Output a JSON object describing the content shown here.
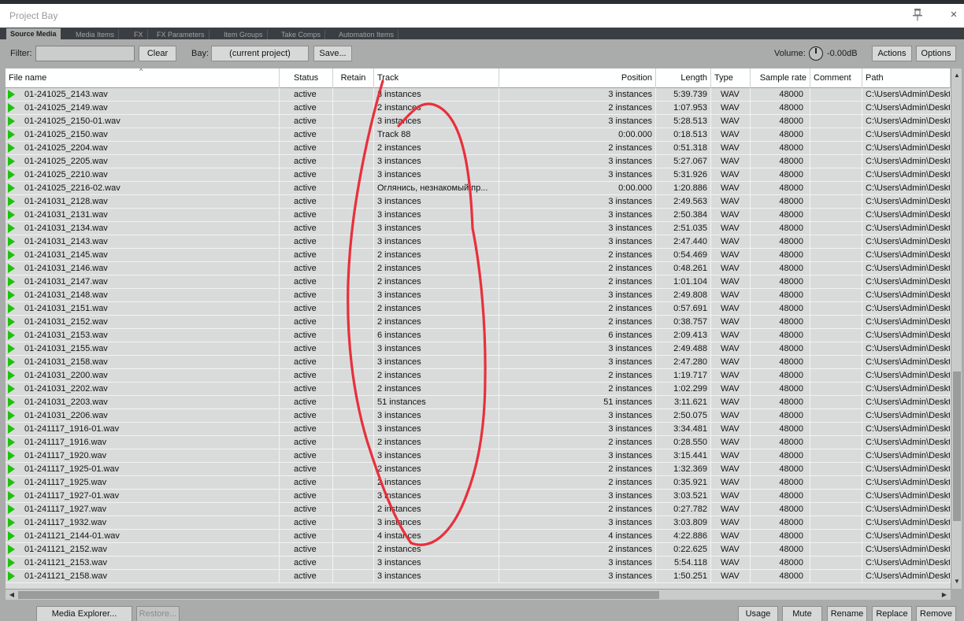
{
  "window": {
    "title": "Project Bay",
    "close_glyph": "×"
  },
  "tabs": [
    "Source Media",
    "Media Items",
    "FX",
    "FX Parameters",
    "Item Groups",
    "Take Comps",
    "Automation Items"
  ],
  "toolbar": {
    "filter_label": "Filter:",
    "filter_value": "",
    "clear_label": "Clear",
    "bay_label": "Bay:",
    "bay_value": "(current project)",
    "save_label": "Save...",
    "volume_label": "Volume:",
    "volume_value": "-0.00dB",
    "actions_label": "Actions",
    "options_label": "Options"
  },
  "table": {
    "columns": [
      "File name",
      "Status",
      "Retain",
      "Track",
      "Position",
      "Length",
      "Type",
      "Sample rate",
      "Comment",
      "Path"
    ],
    "rows": [
      [
        "01-241025_2143.wav",
        "active",
        "",
        "3 instances",
        "3 instances",
        "5:39.739",
        "WAV",
        "48000",
        "",
        "C:\\Users\\Admin\\Deskt"
      ],
      [
        "01-241025_2149.wav",
        "active",
        "",
        "2 instances",
        "2 instances",
        "1:07.953",
        "WAV",
        "48000",
        "",
        "C:\\Users\\Admin\\Deskt"
      ],
      [
        "01-241025_2150-01.wav",
        "active",
        "",
        "3 instances",
        "3 instances",
        "5:28.513",
        "WAV",
        "48000",
        "",
        "C:\\Users\\Admin\\Deskt"
      ],
      [
        "01-241025_2150.wav",
        "active",
        "",
        "Track 88",
        "0:00.000",
        "0:18.513",
        "WAV",
        "48000",
        "",
        "C:\\Users\\Admin\\Deskt"
      ],
      [
        "01-241025_2204.wav",
        "active",
        "",
        "2 instances",
        "2 instances",
        "0:51.318",
        "WAV",
        "48000",
        "",
        "C:\\Users\\Admin\\Deskt"
      ],
      [
        "01-241025_2205.wav",
        "active",
        "",
        "3 instances",
        "3 instances",
        "5:27.067",
        "WAV",
        "48000",
        "",
        "C:\\Users\\Admin\\Deskt"
      ],
      [
        "01-241025_2210.wav",
        "active",
        "",
        "3 instances",
        "3 instances",
        "5:31.926",
        "WAV",
        "48000",
        "",
        "C:\\Users\\Admin\\Deskt"
      ],
      [
        "01-241025_2216-02.wav",
        "active",
        "",
        "Оглянись, незнакомый пр...",
        "0:00.000",
        "1:20.886",
        "WAV",
        "48000",
        "",
        "C:\\Users\\Admin\\Deskt"
      ],
      [
        "01-241031_2128.wav",
        "active",
        "",
        "3 instances",
        "3 instances",
        "2:49.563",
        "WAV",
        "48000",
        "",
        "C:\\Users\\Admin\\Deskt"
      ],
      [
        "01-241031_2131.wav",
        "active",
        "",
        "3 instances",
        "3 instances",
        "2:50.384",
        "WAV",
        "48000",
        "",
        "C:\\Users\\Admin\\Deskt"
      ],
      [
        "01-241031_2134.wav",
        "active",
        "",
        "3 instances",
        "3 instances",
        "2:51.035",
        "WAV",
        "48000",
        "",
        "C:\\Users\\Admin\\Deskt"
      ],
      [
        "01-241031_2143.wav",
        "active",
        "",
        "3 instances",
        "3 instances",
        "2:47.440",
        "WAV",
        "48000",
        "",
        "C:\\Users\\Admin\\Deskt"
      ],
      [
        "01-241031_2145.wav",
        "active",
        "",
        "2 instances",
        "2 instances",
        "0:54.469",
        "WAV",
        "48000",
        "",
        "C:\\Users\\Admin\\Deskt"
      ],
      [
        "01-241031_2146.wav",
        "active",
        "",
        "2 instances",
        "2 instances",
        "0:48.261",
        "WAV",
        "48000",
        "",
        "C:\\Users\\Admin\\Deskt"
      ],
      [
        "01-241031_2147.wav",
        "active",
        "",
        "2 instances",
        "2 instances",
        "1:01.104",
        "WAV",
        "48000",
        "",
        "C:\\Users\\Admin\\Deskt"
      ],
      [
        "01-241031_2148.wav",
        "active",
        "",
        "3 instances",
        "3 instances",
        "2:49.808",
        "WAV",
        "48000",
        "",
        "C:\\Users\\Admin\\Deskt"
      ],
      [
        "01-241031_2151.wav",
        "active",
        "",
        "2 instances",
        "2 instances",
        "0:57.691",
        "WAV",
        "48000",
        "",
        "C:\\Users\\Admin\\Deskt"
      ],
      [
        "01-241031_2152.wav",
        "active",
        "",
        "2 instances",
        "2 instances",
        "0:38.757",
        "WAV",
        "48000",
        "",
        "C:\\Users\\Admin\\Deskt"
      ],
      [
        "01-241031_2153.wav",
        "active",
        "",
        "6 instances",
        "6 instances",
        "2:09.413",
        "WAV",
        "48000",
        "",
        "C:\\Users\\Admin\\Deskt"
      ],
      [
        "01-241031_2155.wav",
        "active",
        "",
        "3 instances",
        "3 instances",
        "2:49.488",
        "WAV",
        "48000",
        "",
        "C:\\Users\\Admin\\Deskt"
      ],
      [
        "01-241031_2158.wav",
        "active",
        "",
        "3 instances",
        "3 instances",
        "2:47.280",
        "WAV",
        "48000",
        "",
        "C:\\Users\\Admin\\Deskt"
      ],
      [
        "01-241031_2200.wav",
        "active",
        "",
        "2 instances",
        "2 instances",
        "1:19.717",
        "WAV",
        "48000",
        "",
        "C:\\Users\\Admin\\Deskt"
      ],
      [
        "01-241031_2202.wav",
        "active",
        "",
        "2 instances",
        "2 instances",
        "1:02.299",
        "WAV",
        "48000",
        "",
        "C:\\Users\\Admin\\Deskt"
      ],
      [
        "01-241031_2203.wav",
        "active",
        "",
        "51 instances",
        "51 instances",
        "3:11.621",
        "WAV",
        "48000",
        "",
        "C:\\Users\\Admin\\Deskt"
      ],
      [
        "01-241031_2206.wav",
        "active",
        "",
        "3 instances",
        "3 instances",
        "2:50.075",
        "WAV",
        "48000",
        "",
        "C:\\Users\\Admin\\Deskt"
      ],
      [
        "01-241117_1916-01.wav",
        "active",
        "",
        "3 instances",
        "3 instances",
        "3:34.481",
        "WAV",
        "48000",
        "",
        "C:\\Users\\Admin\\Deskt"
      ],
      [
        "01-241117_1916.wav",
        "active",
        "",
        "2 instances",
        "2 instances",
        "0:28.550",
        "WAV",
        "48000",
        "",
        "C:\\Users\\Admin\\Deskt"
      ],
      [
        "01-241117_1920.wav",
        "active",
        "",
        "3 instances",
        "3 instances",
        "3:15.441",
        "WAV",
        "48000",
        "",
        "C:\\Users\\Admin\\Deskt"
      ],
      [
        "01-241117_1925-01.wav",
        "active",
        "",
        "2 instances",
        "2 instances",
        "1:32.369",
        "WAV",
        "48000",
        "",
        "C:\\Users\\Admin\\Deskt"
      ],
      [
        "01-241117_1925.wav",
        "active",
        "",
        "2 instances",
        "2 instances",
        "0:35.921",
        "WAV",
        "48000",
        "",
        "C:\\Users\\Admin\\Deskt"
      ],
      [
        "01-241117_1927-01.wav",
        "active",
        "",
        "3 instances",
        "3 instances",
        "3:03.521",
        "WAV",
        "48000",
        "",
        "C:\\Users\\Admin\\Deskt"
      ],
      [
        "01-241117_1927.wav",
        "active",
        "",
        "2 instances",
        "2 instances",
        "0:27.782",
        "WAV",
        "48000",
        "",
        "C:\\Users\\Admin\\Deskt"
      ],
      [
        "01-241117_1932.wav",
        "active",
        "",
        "3 instances",
        "3 instances",
        "3:03.809",
        "WAV",
        "48000",
        "",
        "C:\\Users\\Admin\\Deskt"
      ],
      [
        "01-241121_2144-01.wav",
        "active",
        "",
        "4 instances",
        "4 instances",
        "4:22.886",
        "WAV",
        "48000",
        "",
        "C:\\Users\\Admin\\Deskt"
      ],
      [
        "01-241121_2152.wav",
        "active",
        "",
        "2 instances",
        "2 instances",
        "0:22.625",
        "WAV",
        "48000",
        "",
        "C:\\Users\\Admin\\Deskt"
      ],
      [
        "01-241121_2153.wav",
        "active",
        "",
        "3 instances",
        "3 instances",
        "5:54.118",
        "WAV",
        "48000",
        "",
        "C:\\Users\\Admin\\Deskt"
      ],
      [
        "01-241121_2158.wav",
        "active",
        "",
        "3 instances",
        "3 instances",
        "1:50.251",
        "WAV",
        "48000",
        "",
        "C:\\Users\\Admin\\Deskt"
      ]
    ]
  },
  "bottom": {
    "media_explorer_label": "Media Explorer...",
    "restore_label": "Restore...",
    "usage_label": "Usage",
    "mute_label": "Mute",
    "rename_label": "Rename",
    "replace_label": "Replace",
    "remove_label": "Remove"
  },
  "colors": {
    "annotation": "#e8303c",
    "play_icon": "#1ec10e",
    "tab_bar": "#3a3e42",
    "panel": "#a9acab",
    "list": "#d9dbda"
  }
}
